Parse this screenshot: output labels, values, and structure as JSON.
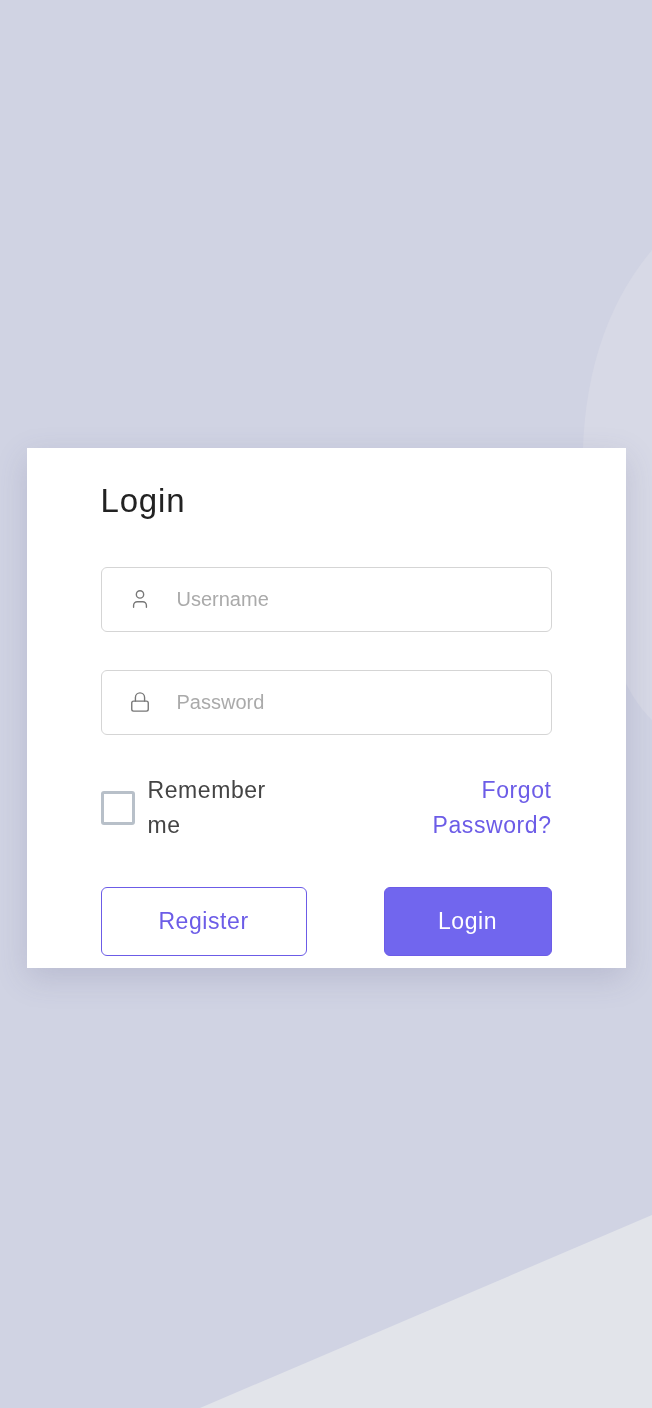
{
  "title": "Login",
  "fields": [
    {
      "kind": "username",
      "placeholder": "Username"
    },
    {
      "kind": "password",
      "placeholder": "Password"
    }
  ],
  "remember": {
    "label": "Remember me",
    "checked": false
  },
  "forgot": {
    "label": "Forgot Password?"
  },
  "buttons": [
    {
      "kind": "secondary",
      "label": "Register"
    },
    {
      "kind": "primary",
      "label": "Login"
    }
  ]
}
